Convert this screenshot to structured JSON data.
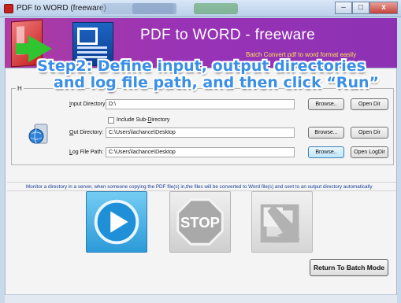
{
  "window": {
    "title": "PDF to WORD (freeware)",
    "controls": {
      "minimize": "–",
      "maximize": "□",
      "close": "x"
    }
  },
  "banner": {
    "title": "PDF to WORD - freeware",
    "subtitle": "Batch Convert  pdf to word format easily"
  },
  "overlay": {
    "line1": "Step2: Define input, output directories",
    "line2": "and log file path, and then click “Run”"
  },
  "form": {
    "group_label": "H",
    "input_dir": {
      "label_key": "I",
      "label_rest": "nput Directory:",
      "value": "D:\\"
    },
    "include_sub": {
      "label_pre": "Include Sub-",
      "label_key": "D",
      "label_rest": "irectory",
      "checked": false
    },
    "out_dir": {
      "label_key": "O",
      "label_rest": "ut Directory:",
      "value": "C:\\Users\\lachance\\Desktop"
    },
    "log_path": {
      "label_key": "L",
      "label_rest": "og File Path:",
      "value": "C:\\Users\\lachance\\Desktop"
    },
    "buttons": {
      "browse_input": "Browse..",
      "open_dir": "Open Dir",
      "browse_output": "Browse...",
      "open_output": "Open Dir",
      "browse_log": "Browse..",
      "open_logdir": "Open LogDir"
    }
  },
  "monitor_text": "Monitor a directory in a server, when someone copying the PDF file(s) in,the files will be converted to Word file(s) and sent to an output directory automatically",
  "actions": {
    "stop_label": "STOP"
  },
  "return_button": "Return To Batch Mode",
  "colors": {
    "banner": "#9933b6",
    "banner_subtitle": "#ffe15a",
    "overlay_text": "#3a8fe6",
    "monitor_text": "#1a3c9a",
    "stop_sign": "#a9a9a9"
  }
}
